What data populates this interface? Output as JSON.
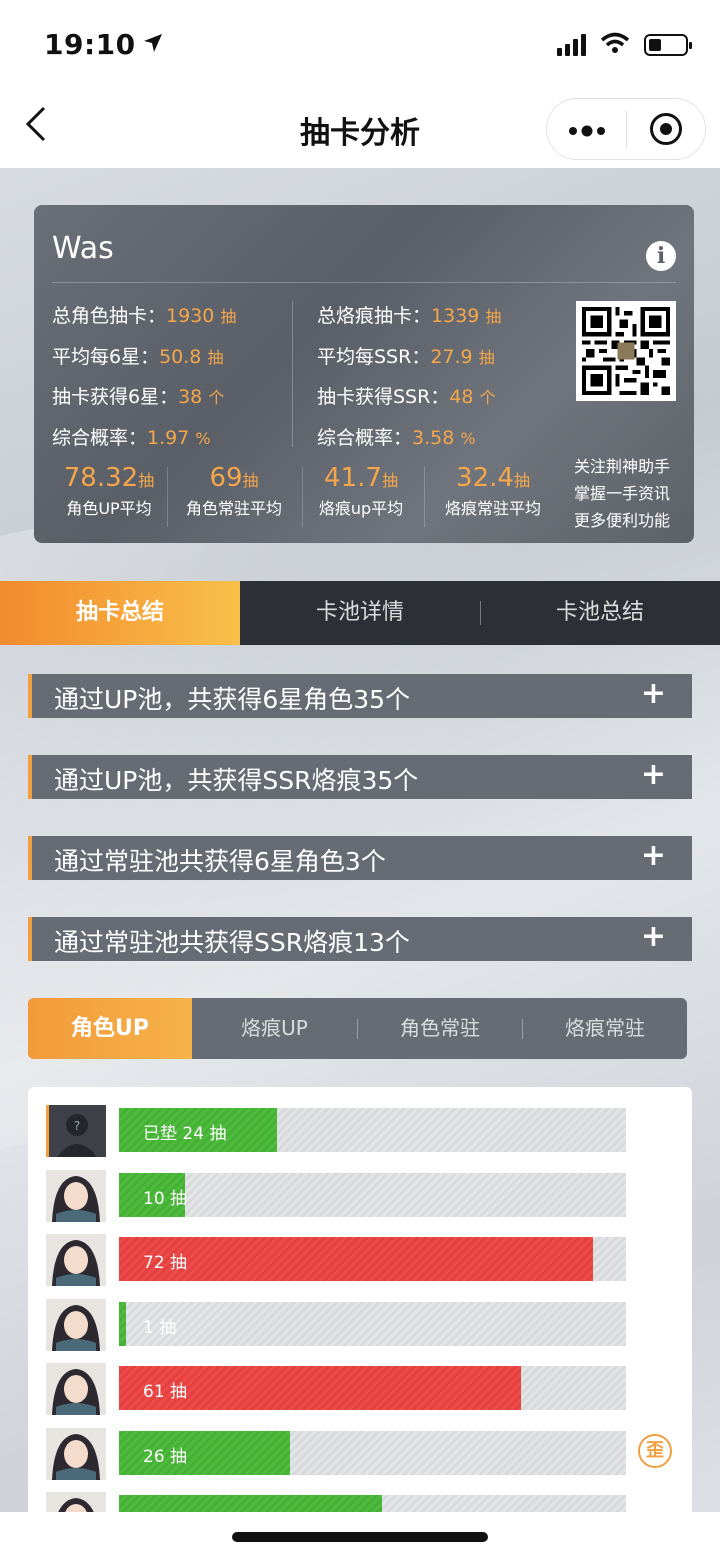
{
  "status": {
    "time": "19:10"
  },
  "nav": {
    "title": "抽卡分析"
  },
  "profile": {
    "username": "Was",
    "left_stats": [
      {
        "label": "总角色抽卡：",
        "value": "1930",
        "unit": "抽"
      },
      {
        "label": "平均每6星：",
        "value": "50.8",
        "unit": "抽"
      },
      {
        "label": "抽卡获得6星：",
        "value": "38",
        "unit": "个"
      },
      {
        "label": "综合概率：",
        "value": "1.97",
        "unit": "%"
      }
    ],
    "right_stats": [
      {
        "label": "总烙痕抽卡：",
        "value": "1339",
        "unit": "抽"
      },
      {
        "label": "平均每SSR：",
        "value": "27.9",
        "unit": "抽"
      },
      {
        "label": "抽卡获得SSR：",
        "value": "48",
        "unit": "个"
      },
      {
        "label": "综合概率：",
        "value": "3.58",
        "unit": "%"
      }
    ],
    "averages": [
      {
        "value": "78.32",
        "unit": "抽",
        "label": "角色UP平均"
      },
      {
        "value": "69",
        "unit": "抽",
        "label": "角色常驻平均"
      },
      {
        "value": "41.7",
        "unit": "抽",
        "label": "烙痕up平均"
      },
      {
        "value": "32.4",
        "unit": "抽",
        "label": "烙痕常驻平均"
      }
    ],
    "promo": [
      "关注荆神助手",
      "掌握一手资讯",
      "更多便利功能"
    ]
  },
  "main_tabs": [
    "抽卡总结",
    "卡池详情",
    "卡池总结"
  ],
  "summary_rows": [
    "通过UP池，共获得6星角色35个",
    "通过UP池，共获得SSR烙痕35个",
    "通过常驻池共获得6星角色3个",
    "通过常驻池共获得SSR烙痕13个"
  ],
  "sub_tabs": [
    "角色UP",
    "烙痕UP",
    "角色常驻",
    "烙痕常驻"
  ],
  "pulls": [
    {
      "label": "已垫 24 抽",
      "count": 24,
      "color": "green",
      "avatar": "unknown-avatar"
    },
    {
      "label": "10 抽",
      "count": 10,
      "color": "green",
      "avatar": "character-avatar"
    },
    {
      "label": "72 抽",
      "count": 72,
      "color": "red",
      "avatar": "character-avatar"
    },
    {
      "label": "1 抽",
      "count": 1,
      "color": "green",
      "avatar": "character-avatar"
    },
    {
      "label": "61 抽",
      "count": 61,
      "color": "red",
      "avatar": "character-avatar"
    },
    {
      "label": "26 抽",
      "count": 26,
      "color": "green",
      "avatar": "character-avatar",
      "badge": "歪"
    },
    {
      "label": "",
      "count": 40,
      "color": "green",
      "avatar": "character-avatar"
    }
  ],
  "pull_scale_max": 77,
  "colors": {
    "accent": "#f0a040",
    "green": "#4dbb3c",
    "red": "#ef4a4a"
  }
}
